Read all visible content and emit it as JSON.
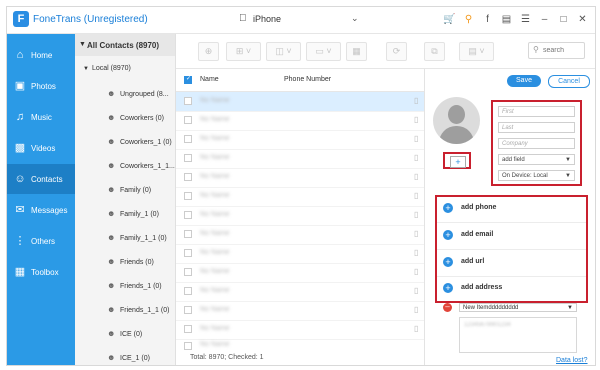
{
  "app": {
    "title": "FoneTrans (Unregistered)",
    "logo_letter": "F"
  },
  "device": {
    "name": "iPhone"
  },
  "window_icons": [
    "cart-icon",
    "key-icon",
    "facebook-icon",
    "chat-icon",
    "menu-icon",
    "minimize-icon",
    "maximize-icon",
    "close-icon"
  ],
  "sidebar": {
    "items": [
      {
        "label": "Home",
        "icon": "home-icon"
      },
      {
        "label": "Photos",
        "icon": "photos-icon"
      },
      {
        "label": "Music",
        "icon": "music-icon"
      },
      {
        "label": "Videos",
        "icon": "videos-icon"
      },
      {
        "label": "Contacts",
        "icon": "contacts-icon",
        "active": true
      },
      {
        "label": "Messages",
        "icon": "messages-icon"
      },
      {
        "label": "Others",
        "icon": "others-icon"
      },
      {
        "label": "Toolbox",
        "icon": "toolbox-icon"
      }
    ]
  },
  "tree": {
    "all_contacts": "All Contacts",
    "all_count": "(8970)",
    "local_label": "Local",
    "local_count": "(8970)",
    "groups": [
      "Ungrouped (8...",
      "Coworkers (0)",
      "Coworkers_1 (0)",
      "Coworkers_1_1...",
      "Family (0)",
      "Family_1 (0)",
      "Family_1_1 (0)",
      "Friends (0)",
      "Friends_1 (0)",
      "Friends_1_1 (0)",
      "ICE (0)",
      "ICE_1 (0)"
    ]
  },
  "search": {
    "placeholder": "search"
  },
  "list": {
    "col_name": "Name",
    "col_phone": "Phone Number",
    "rows": [
      "No Name",
      "No Name",
      "No Name",
      "No Name",
      "No Name",
      "No Name",
      "No Name",
      "No Name",
      "No Name",
      "No Name",
      "No Name",
      "No Name",
      "No Name",
      "No Name"
    ],
    "selected_index": 0,
    "footer": "Total: 8970; Checked: 1"
  },
  "detail": {
    "save": "Save",
    "cancel": "Cancel",
    "add_photo": "+",
    "first_placeholder": "First",
    "last_placeholder": "Last",
    "company_placeholder": "Company",
    "add_field": "add field",
    "on_device": "On Device: Local",
    "add_phone": "add phone",
    "add_email": "add email",
    "add_url": "add url",
    "add_address": "add address",
    "new_item": "New Itemddddddddd",
    "new_item_text": "12345678901234",
    "data_lost": "Data lost?"
  },
  "colors": {
    "accent": "#2b9ae6",
    "sidebar_active": "#1d7fc6",
    "highlight_red": "#c9202e",
    "brand_orange": "#f39a1e"
  }
}
